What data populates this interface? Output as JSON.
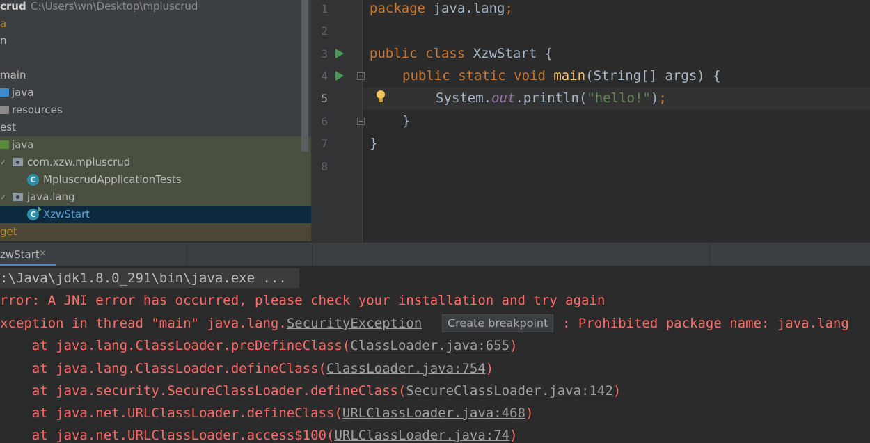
{
  "project": {
    "name": "crud",
    "path": "C:\\Users\\wn\\Desktop\\mpluscrud",
    "items": [
      {
        "label": "a"
      },
      {
        "label": "n"
      },
      {
        "label": "main"
      },
      {
        "label": "java"
      },
      {
        "label": "resources"
      },
      {
        "label": "est"
      },
      {
        "label": "java"
      },
      {
        "label": "com.xzw.mpluscrud"
      },
      {
        "label": "MpluscrudApplicationTests"
      },
      {
        "label": "java.lang"
      },
      {
        "label": "XzwStart"
      },
      {
        "label": "get"
      }
    ]
  },
  "editor": {
    "line_numbers": [
      "1",
      "2",
      "3",
      "4",
      "5",
      "6",
      "7",
      "8"
    ],
    "current_line": "5",
    "lines": {
      "l1_kw": "package",
      "l1_rest": " java.lang",
      "l1_semi": ";",
      "l3_kw": "public class",
      "l3_rest": " XzwStart {",
      "l4_kw": "public static void",
      "l4_fn": " main",
      "l4_rest": "(String[] args) {",
      "l5_a": "System.",
      "l5_field": "out",
      "l5_b": ".println(",
      "l5_str": "\"hello!\"",
      "l5_c": ")",
      "l5_semi": ";",
      "l6": "}",
      "l7": "}"
    }
  },
  "run": {
    "tab_label": "zwStart",
    "close_glyph": "×",
    "console": {
      "cmd": ":\\Java\\jdk1.8.0_291\\bin\\java.exe ...",
      "err1": "rror: A JNI error has occurred, please check your installation and try again",
      "err2_pre": "xception in thread \"main\" java.lang.",
      "err2_link": "SecurityException",
      "err2_post": ": Prohibited package name: java.lang",
      "tooltip": "Create breakpoint",
      "stack": [
        {
          "pre": "    at java.lang.ClassLoader.preDefineClass(",
          "link": "ClassLoader.java:655",
          "post": ")"
        },
        {
          "pre": "    at java.lang.ClassLoader.defineClass(",
          "link": "ClassLoader.java:754",
          "post": ")"
        },
        {
          "pre": "    at java.security.SecureClassLoader.defineClass(",
          "link": "SecureClassLoader.java:142",
          "post": ")"
        },
        {
          "pre": "    at java.net.URLClassLoader.defineClass(",
          "link": "URLClassLoader.java:468",
          "post": ")"
        },
        {
          "pre": "    at java.net.URLClassLoader.access$100(",
          "link": "URLClassLoader.java:74",
          "post": ")"
        }
      ]
    }
  },
  "colors": {
    "error": "#ff6b68",
    "keyword": "#cc7832",
    "string": "#6a8759",
    "selection": "#0d293e"
  }
}
